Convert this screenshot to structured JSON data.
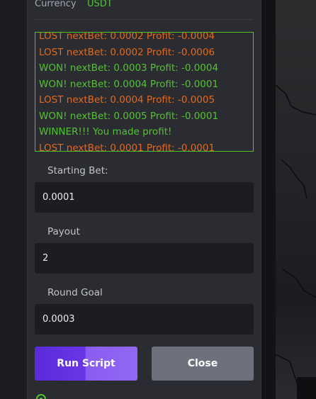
{
  "currency": {
    "label": "Currency",
    "value": "USDT"
  },
  "log": {
    "lines": [
      {
        "text": "LOST nextBet: 0.0002 Profit: -0.0004",
        "status": "lost"
      },
      {
        "text": "LOST nextBet: 0.0002 Profit: -0.0006",
        "status": "lost"
      },
      {
        "text": "WON! nextBet: 0.0003 Profit: -0.0004",
        "status": "won"
      },
      {
        "text": "WON! nextBet: 0.0004 Profit: -0.0001",
        "status": "won"
      },
      {
        "text": "LOST nextBet: 0.0004 Profit: -0.0005",
        "status": "lost"
      },
      {
        "text": "WON! nextBet: 0.0005 Profit: -0.0001",
        "status": "won"
      },
      {
        "text": "WINNER!!! You made profit!",
        "status": "won"
      },
      {
        "text": "LOST nextBet: 0.0001 Profit: -0.0001",
        "status": "lost"
      }
    ]
  },
  "fields": {
    "starting_bet": {
      "label": "Starting Bet:",
      "value": "0.0001"
    },
    "payout": {
      "label": "Payout",
      "value": "2"
    },
    "round_goal": {
      "label": "Round Goal",
      "value": "0.0003"
    }
  },
  "buttons": {
    "run_label": "Run Script",
    "close_label": "Close"
  },
  "colors": {
    "lost": "#e2691f",
    "won": "#56c233",
    "accent": "#6a35e6",
    "log_border": "#4fc32b"
  }
}
